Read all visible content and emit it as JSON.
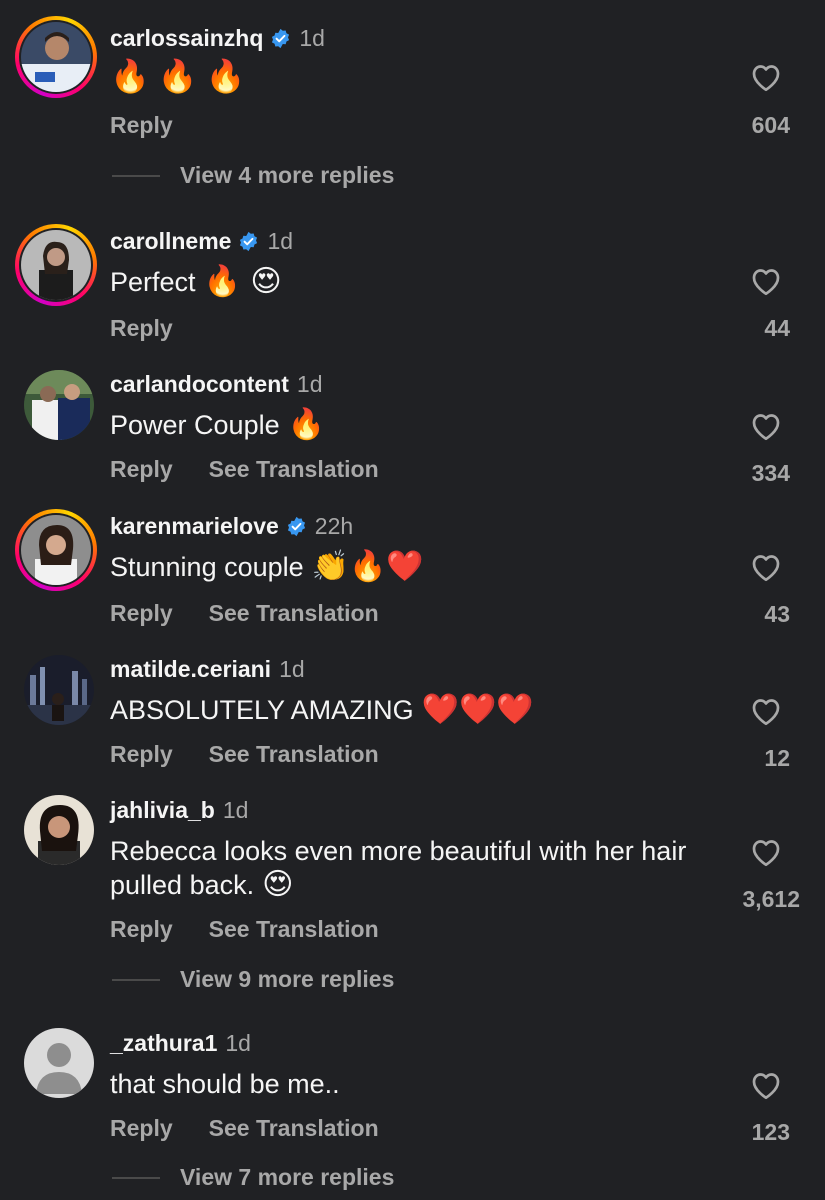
{
  "comments": [
    {
      "username": "carlossainzhq",
      "verified": true,
      "time": "1d",
      "text": "",
      "emoji": "🔥🔥🔥",
      "actions": [
        "Reply"
      ],
      "likes": "604",
      "view_more": "View 4 more replies"
    },
    {
      "username": "carollneme",
      "verified": true,
      "time": "1d",
      "text": "Perfect",
      "emoji": "🔥 😍",
      "actions": [
        "Reply"
      ],
      "likes": "44"
    },
    {
      "username": "carlandocontent",
      "verified": false,
      "time": "1d",
      "text": "Power Couple",
      "emoji": "🔥",
      "actions": [
        "Reply",
        "See Translation"
      ],
      "likes": "334"
    },
    {
      "username": "karenmarielove",
      "verified": true,
      "time": "22h",
      "text": "Stunning couple",
      "emoji": "👏🔥❤️",
      "actions": [
        "Reply",
        "See Translation"
      ],
      "likes": "43"
    },
    {
      "username": "matilde.ceriani",
      "verified": false,
      "time": "1d",
      "text": "ABSOLUTELY AMAZING",
      "emoji": "❤️❤️❤️",
      "actions": [
        "Reply",
        "See Translation"
      ],
      "likes": "12"
    },
    {
      "username": "jahlivia_b",
      "verified": false,
      "time": "1d",
      "text": "Rebecca looks even more beautiful with her hair pulled back.",
      "emoji": "😍",
      "actions": [
        "Reply",
        "See Translation"
      ],
      "likes": "3,612",
      "view_more": "View 9 more replies"
    },
    {
      "username": "_zathura1",
      "verified": false,
      "time": "1d",
      "text": "that should be me..",
      "emoji": "",
      "actions": [
        "Reply",
        "See Translation"
      ],
      "likes": "123",
      "view_more": "View 7 more replies"
    }
  ],
  "colors": {
    "background": "#202124",
    "primary_text": "#f5f5f5",
    "secondary_text": "#a8a8a8",
    "verified_badge": "#3897f0"
  }
}
